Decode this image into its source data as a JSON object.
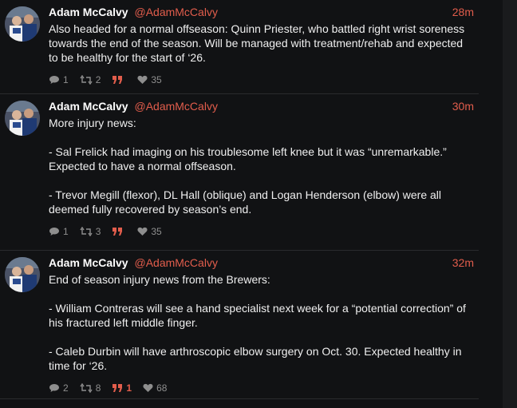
{
  "tweets": [
    {
      "name": "Adam McCalvy",
      "handle": "@AdamMcCalvy",
      "time": "28m",
      "text": "Also headed for a normal offseason: Quinn Priester, who battled right wrist soreness towards the end of the season. Will be managed with treatment/rehab and expected to be healthy for the start of ‘26.",
      "replies": "1",
      "retweets": "2",
      "quotes": "",
      "likes": "35"
    },
    {
      "name": "Adam McCalvy",
      "handle": "@AdamMcCalvy",
      "time": "30m",
      "text": "More injury news:\n\n- Sal Frelick had imaging on his troublesome left knee but it was “unremarkable.” Expected to have a normal offseason.\n\n- Trevor Megill (flexor), DL Hall (oblique) and Logan Henderson (elbow) were all deemed fully recovered by season’s end.",
      "replies": "1",
      "retweets": "3",
      "quotes": "",
      "likes": "35"
    },
    {
      "name": "Adam McCalvy",
      "handle": "@AdamMcCalvy",
      "time": "32m",
      "text": "End of season injury news from the Brewers:\n\n- William Contreras will see a hand specialist next week for a “potential correction” of his fractured left middle finger.\n\n- Caleb Durbin will have arthroscopic elbow surgery on Oct. 30. Expected healthy in time for ‘26.",
      "replies": "2",
      "retweets": "8",
      "quotes": "1",
      "likes": "68"
    }
  ],
  "colors": {
    "accent": "#e25d4c",
    "background": "#111214",
    "muted": "#8e8e8e"
  },
  "icons": {
    "reply": "speech-bubble-icon",
    "retweet": "retweet-icon",
    "quote": "quote-icon",
    "like": "heart-icon"
  }
}
